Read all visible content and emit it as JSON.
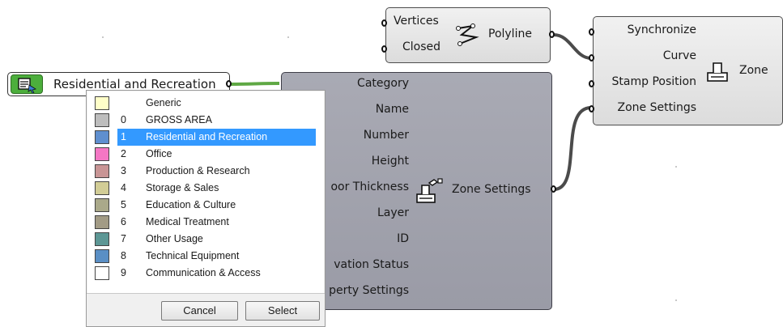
{
  "components": {
    "polyline": {
      "inputs": [
        "Vertices",
        "Closed"
      ],
      "name": "Polyline"
    },
    "zone": {
      "inputs": [
        "Synchronize",
        "Curve",
        "Stamp Position",
        "Zone Settings"
      ],
      "name": "Zone"
    },
    "zone_settings": {
      "inputs": [
        "Category",
        "Name",
        "Number",
        "Height",
        "oor Thickness",
        "Layer",
        "ID",
        "vation Status",
        "perty Settings"
      ],
      "name": "Zone Settings"
    }
  },
  "value_list": {
    "selected": "Residential and Recreation"
  },
  "dropdown": {
    "items": [
      {
        "number": "",
        "name": "Generic",
        "color": "#ffffc8"
      },
      {
        "number": "0",
        "name": "GROSS AREA",
        "color": "#bdbdbd"
      },
      {
        "number": "1",
        "name": "Residential and Recreation",
        "color": "#5f8fcf",
        "selected": true
      },
      {
        "number": "2",
        "name": "Office",
        "color": "#f477c4"
      },
      {
        "number": "3",
        "name": "Production & Research",
        "color": "#c89595"
      },
      {
        "number": "4",
        "name": "Storage & Sales",
        "color": "#d2cd96"
      },
      {
        "number": "5",
        "name": "Education & Culture",
        "color": "#aaa98a"
      },
      {
        "number": "6",
        "name": "Medical Treatment",
        "color": "#a29b85"
      },
      {
        "number": "7",
        "name": "Other Usage",
        "color": "#5d9795"
      },
      {
        "number": "8",
        "name": "Technical Equipment",
        "color": "#5a8fc5"
      },
      {
        "number": "9",
        "name": "Communication & Access",
        "color": "#ffffff"
      }
    ],
    "cancel_label": "Cancel",
    "select_label": "Select"
  }
}
